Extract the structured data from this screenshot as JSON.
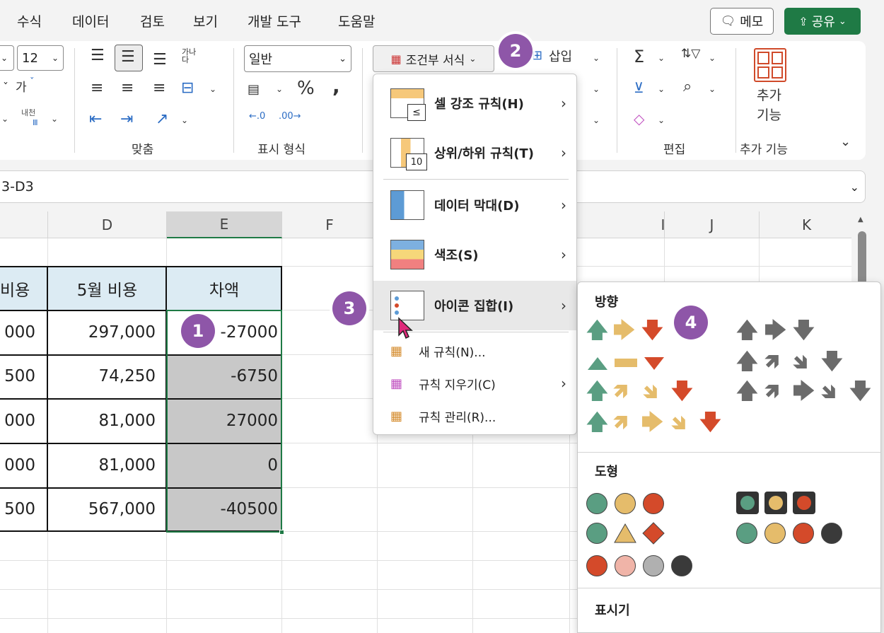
{
  "menubar": {
    "items": [
      "수식",
      "데이터",
      "검토",
      "보기",
      "개발 도구",
      "도움말"
    ],
    "memo_label": "메모",
    "share_label": "공유"
  },
  "ribbon": {
    "font_size": "12",
    "number_format": "일반",
    "groups": {
      "alignment": "맞춤",
      "number": "표시 형식",
      "editing": "편집",
      "addins": "추가 기능"
    },
    "conditional_format": "조건부 서식",
    "insert": "삽입",
    "addins_button": [
      "추가",
      "기능"
    ],
    "wrap_label": "가나\n다",
    "indent_label": "내천",
    "bold_ga": "가"
  },
  "formula_bar": {
    "text": "3-D3"
  },
  "sheet": {
    "columns": [
      "D",
      "E",
      "F",
      "I",
      "J",
      "K"
    ],
    "headers": {
      "c": "비용",
      "d": "5월 비용",
      "e": "차액"
    },
    "rows": [
      {
        "c": "000",
        "d": "297,000",
        "e": "-27000"
      },
      {
        "c": "500",
        "d": "74,250",
        "e": "-6750"
      },
      {
        "c": "000",
        "d": "81,000",
        "e": "27000"
      },
      {
        "c": "000",
        "d": "81,000",
        "e": "0"
      },
      {
        "c": "500",
        "d": "567,000",
        "e": "-40500"
      }
    ]
  },
  "dropdown": {
    "items": [
      {
        "label": "셀 강조 규칙(H)",
        "has_submenu": true
      },
      {
        "label": "상위/하위 규칙(T)",
        "has_submenu": true
      },
      {
        "label": "데이터 막대(D)",
        "has_submenu": true
      },
      {
        "label": "색조(S)",
        "has_submenu": true
      },
      {
        "label": "아이콘 집합(I)",
        "has_submenu": true
      }
    ],
    "subitems": [
      {
        "label": "새 규칙(N)...",
        "has_submenu": false
      },
      {
        "label": "규칙 지우기(C)",
        "has_submenu": true
      },
      {
        "label": "규칙 관리(R)...",
        "has_submenu": false
      }
    ]
  },
  "icon_panel": {
    "sections": [
      "방향",
      "도형",
      "표시기"
    ]
  },
  "badges": [
    "1",
    "2",
    "3",
    "4"
  ],
  "colors": {
    "green": "#5a9e82",
    "yellow": "#e5bc6b",
    "red": "#d44a2a",
    "gray": "#6b6b6b",
    "header_fill": "#dcebf3",
    "selection_fill": "#c8c8c8",
    "badge": "#8e56a8",
    "share": "#1f7a45"
  }
}
